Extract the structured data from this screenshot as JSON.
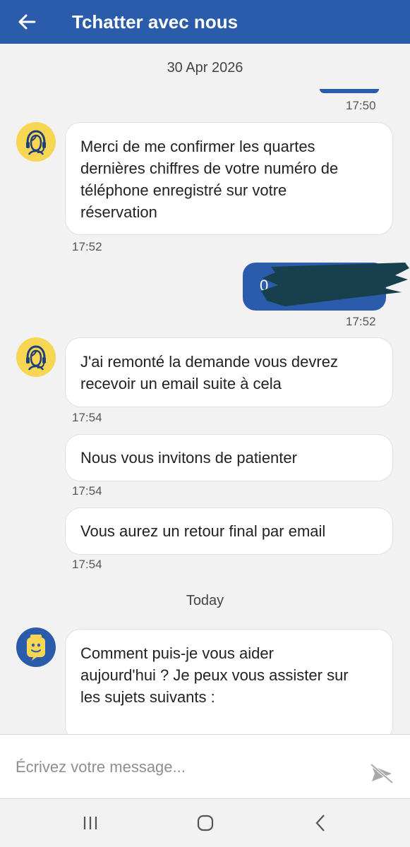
{
  "header": {
    "title": "Tchatter avec nous",
    "back_icon": "arrow-left-icon"
  },
  "colors": {
    "header_bg": "#2a5cab",
    "background": "#f2f2f2",
    "agent_avatar_bg": "#f7d653",
    "bot_avatar_bg": "#2a5cab",
    "sent_bubble": "#2a5cab"
  },
  "chat": {
    "date_separator_1": "30 Apr 2026",
    "sent_1_time": "17:50",
    "msg_1": {
      "lines": [
        "Merci de me confirmer les quartes",
        "dernières chiffres de votre numéro de",
        "téléphone enregistré sur votre",
        "réservation"
      ],
      "time": "17:52"
    },
    "sent_2": {
      "visible_fragment": "0",
      "time": "17:52"
    },
    "msg_2": {
      "lines": [
        "J'ai remonté la demande vous devrez",
        "recevoir un email suite à cela"
      ],
      "time": "17:54"
    },
    "msg_3": {
      "text": "Nous vous invitons de patienter",
      "time": "17:54"
    },
    "msg_4": {
      "text": "Vous aurez un retour final par email",
      "time": "17:54"
    },
    "date_separator_2": "Today",
    "msg_5": {
      "lines": [
        "Comment puis-je vous aider",
        "aujourd'hui ? Je peux vous assister sur",
        "les sujets suivants :"
      ]
    }
  },
  "composer": {
    "placeholder": "Écrivez votre message...",
    "send_icon": "send-disabled-icon"
  },
  "navbar": {
    "recents_icon": "recents-icon",
    "home_icon": "home-icon",
    "back_icon": "nav-back-icon"
  }
}
